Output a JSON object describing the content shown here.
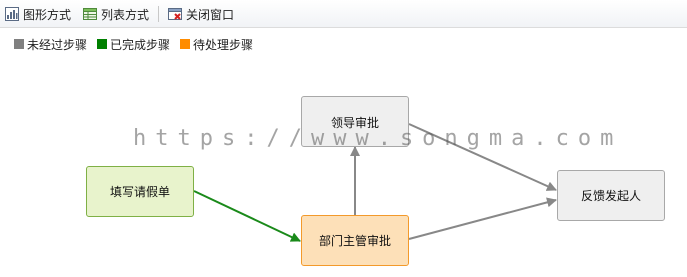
{
  "toolbar": {
    "graph_view": "图形方式",
    "list_view": "列表方式",
    "close_window": "关闭窗口"
  },
  "legend": [
    {
      "label": "未经过步骤",
      "color": "#808080"
    },
    {
      "label": "已完成步骤",
      "color": "#008000"
    },
    {
      "label": "待处理步骤",
      "color": "#ff8c00"
    }
  ],
  "nodes": {
    "fill_leave": {
      "label": "填写请假单",
      "status": "completed",
      "fill": "#e8f3cc",
      "border": "#7fb045"
    },
    "dept_approval": {
      "label": "部门主管审批",
      "status": "pending",
      "fill": "#fde0b8",
      "border": "#f39a2b"
    },
    "leader_approval": {
      "label": "领导审批",
      "status": "not-passed",
      "fill": "#efefef",
      "border": "#a8a8a8"
    },
    "feedback": {
      "label": "反馈发起人",
      "status": "not-passed",
      "fill": "#efefef",
      "border": "#a8a8a8"
    }
  },
  "watermark": "https://www.songma.com"
}
